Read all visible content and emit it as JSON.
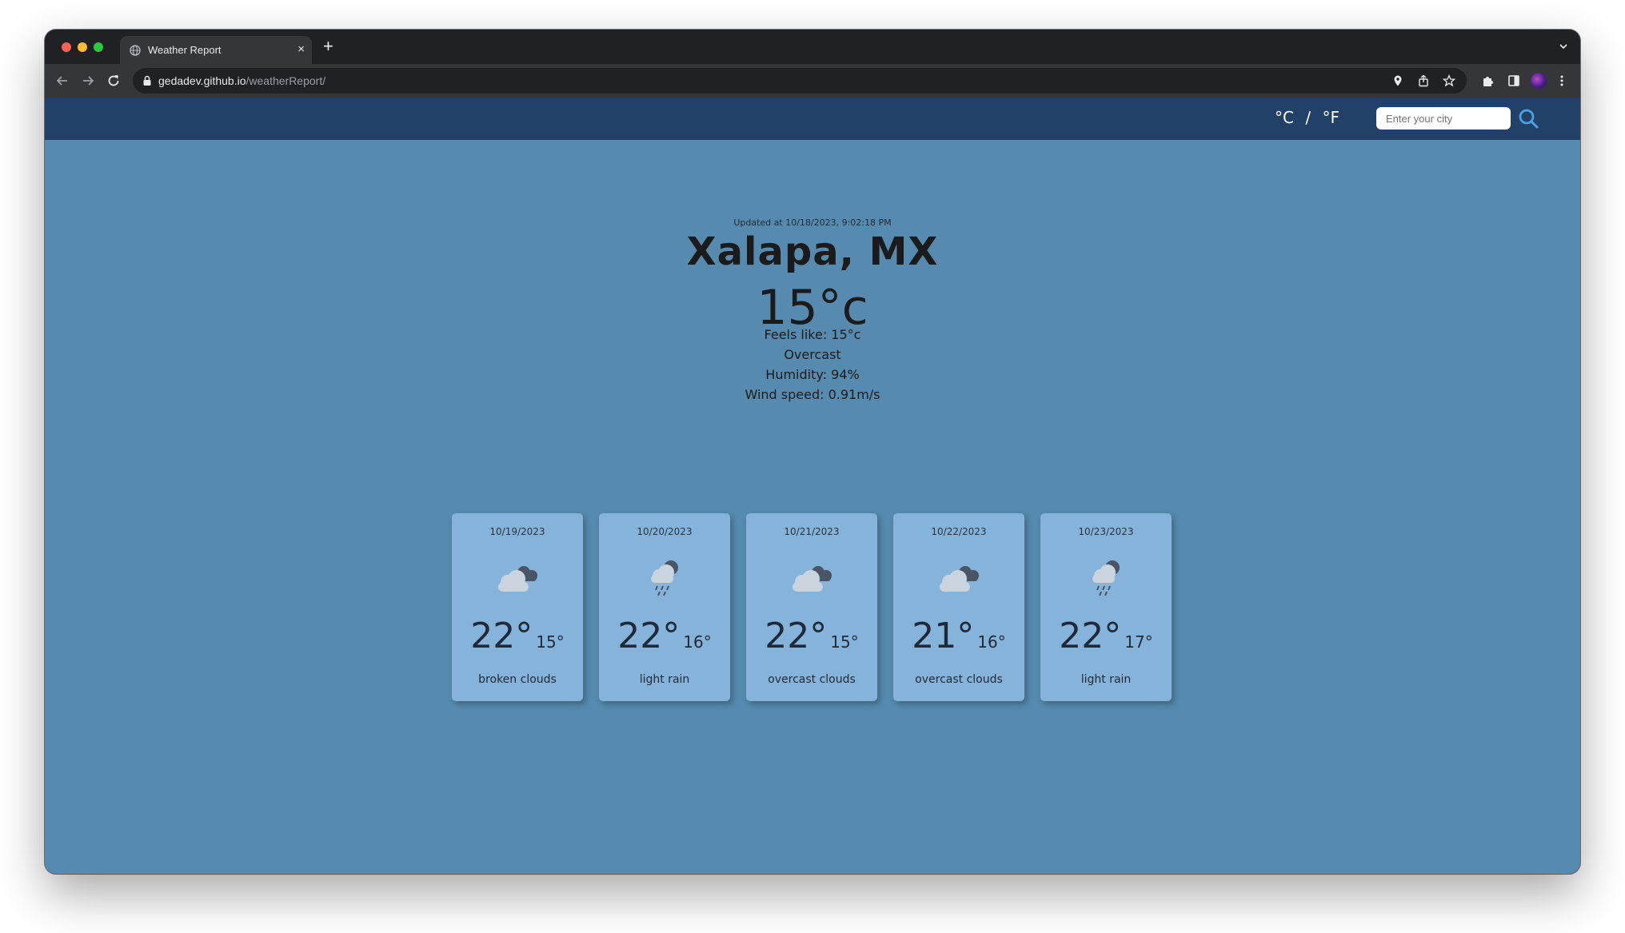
{
  "browser": {
    "tab_title": "Weather Report",
    "tab_close": "×",
    "new_tab": "+",
    "url_host": "gedadev.github.io",
    "url_path": "/weatherReport/"
  },
  "header": {
    "unit_celsius": "°C",
    "unit_separator": "/",
    "unit_fahrenheit": "°F",
    "search_placeholder": "Enter your city"
  },
  "current": {
    "updated": "Updated at 10/18/2023, 9:02:18 PM",
    "city": "Xalapa, MX",
    "temperature": "15°c",
    "feels_like": "Feels like: 15°c",
    "condition": "Overcast",
    "humidity": "Humidity: 94%",
    "wind": "Wind speed: 0.91m/s"
  },
  "forecast": [
    {
      "date": "10/19/2023",
      "max": "22°",
      "min": "15°",
      "description": "broken clouds",
      "icon": "broken-clouds-icon"
    },
    {
      "date": "10/20/2023",
      "max": "22°",
      "min": "16°",
      "description": "light rain",
      "icon": "light-rain-icon"
    },
    {
      "date": "10/21/2023",
      "max": "22°",
      "min": "15°",
      "description": "overcast clouds",
      "icon": "overcast-clouds-icon"
    },
    {
      "date": "10/22/2023",
      "max": "21°",
      "min": "16°",
      "description": "overcast clouds",
      "icon": "overcast-clouds-icon"
    },
    {
      "date": "10/23/2023",
      "max": "22°",
      "min": "17°",
      "description": "light rain",
      "icon": "light-rain-icon"
    }
  ],
  "colors": {
    "page_background": "#568baf",
    "header_background": "#224169",
    "card_background": "#85b3da"
  }
}
